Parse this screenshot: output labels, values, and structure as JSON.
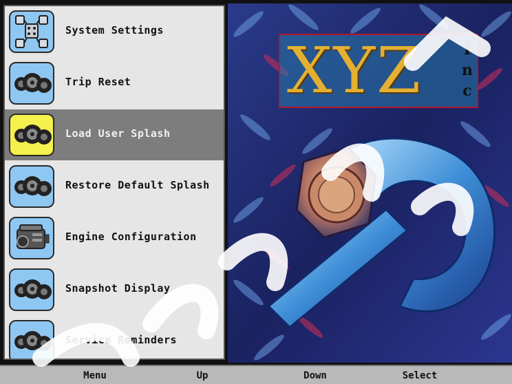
{
  "menu": {
    "items": [
      {
        "label": "System Settings",
        "icon": "system-settings-icon",
        "selected": false
      },
      {
        "label": "Trip Reset",
        "icon": "gauge-cluster-icon",
        "selected": false
      },
      {
        "label": "Load User Splash",
        "icon": "gauge-cluster-icon",
        "selected": true
      },
      {
        "label": "Restore Default Splash",
        "icon": "gauge-cluster-icon",
        "selected": false
      },
      {
        "label": "Engine Configuration",
        "icon": "engine-icon",
        "selected": false
      },
      {
        "label": "Snapshot Display",
        "icon": "gauge-cluster-icon",
        "selected": false
      },
      {
        "label": "Service Reminders",
        "icon": "gauge-cluster-icon",
        "selected": false
      }
    ]
  },
  "splash": {
    "logo_main": "XYZ",
    "logo_suffix": [
      "I",
      "n",
      "c"
    ]
  },
  "softkeys": {
    "menu": "Menu",
    "up": "Up",
    "down": "Down",
    "select": "Select"
  },
  "colors": {
    "selected_highlight": "#7d7d7d",
    "selected_icon_bg": "#f4f04e",
    "icon_bg": "#8fc7f3",
    "logo_gold": "#e3b033"
  }
}
